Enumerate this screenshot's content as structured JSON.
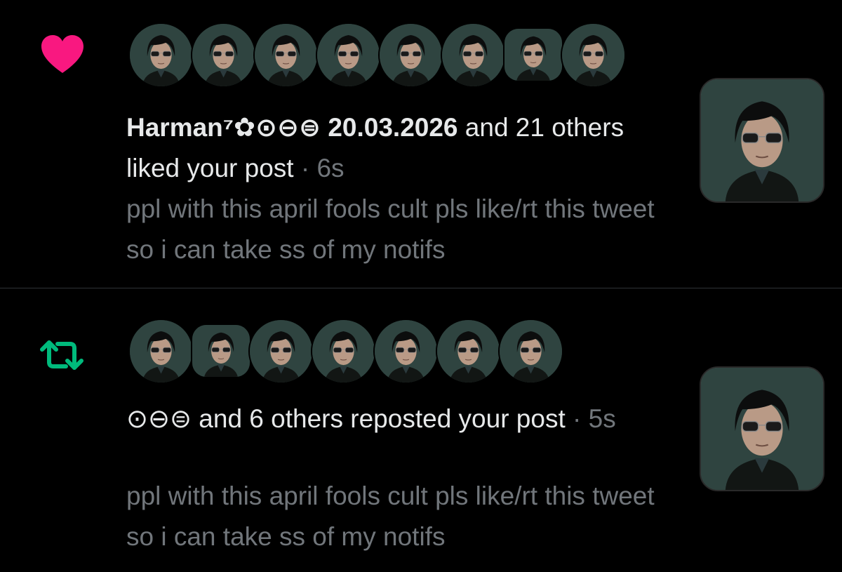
{
  "colors": {
    "background": "#000000",
    "like_accent": "#f91880",
    "repost_accent": "#00ba7c",
    "primary_text": "#e7e9ea",
    "secondary_text": "#71767b",
    "divider": "#2f3336"
  },
  "notifications": [
    {
      "type_icon": "heart-icon",
      "actor_name": "Harman⁷✿⊙⊖⊜ 20.03.2026",
      "action": " and 21 others liked your post",
      "separator": " · ",
      "time": "6s",
      "post_preview": "ppl with this april fools cult pls like/rt this tweet so i can take ss of my notifs",
      "avatar_count": 8
    },
    {
      "type_icon": "repost-icon",
      "actor_name": "⊙⊖⊜",
      "action": " and 6 others reposted your post",
      "separator": " · ",
      "time": "5s",
      "post_preview": "ppl with this april fools cult pls like/rt this tweet so i can take ss of my notifs",
      "avatar_count": 7
    }
  ]
}
